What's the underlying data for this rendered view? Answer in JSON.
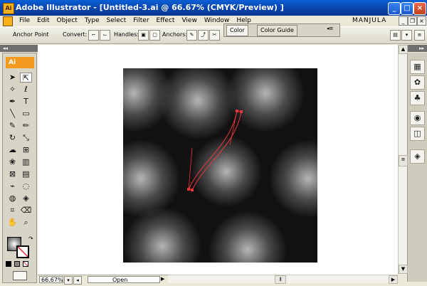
{
  "window": {
    "app_icon": "Ai",
    "title": "Adobe Illustrator - [Untitled-3.ai @ 66.67% (CMYK/Preview) ]",
    "controls": [
      "minimize-icon",
      "maximize-icon",
      "close-icon"
    ]
  },
  "menu": {
    "items": [
      "File",
      "Edit",
      "Object",
      "Type",
      "Select",
      "Filter",
      "Effect",
      "View",
      "Window",
      "Help"
    ],
    "user": "MANJULA"
  },
  "control_bar": {
    "tool_label": "Anchor Point",
    "convert_label": "Convert:",
    "handles_label": "Handles:",
    "anchors_label": "Anchors:"
  },
  "panel": {
    "tabs": [
      "Color",
      "Color Guide"
    ],
    "active_tab": "Color"
  },
  "toolbox": {
    "logo": "Ai",
    "collapse_label": "◂◂",
    "tools": [
      [
        "selection-tool",
        "direct-selection-tool"
      ],
      [
        "magic-wand-tool",
        "lasso-tool"
      ],
      [
        "pen-tool",
        "type-tool"
      ],
      [
        "line-segment-tool",
        "rectangle-tool"
      ],
      [
        "paintbrush-tool",
        "pencil-tool"
      ],
      [
        "rotate-tool",
        "scale-tool"
      ],
      [
        "warp-tool",
        "free-transform-tool"
      ],
      [
        "symbol-sprayer-tool",
        "column-graph-tool"
      ],
      [
        "mesh-tool",
        "gradient-tool"
      ],
      [
        "eyedropper-tool",
        "blend-tool"
      ],
      [
        "live-paint-bucket-tool",
        "live-paint-selection-tool"
      ],
      [
        "crop-area-tool",
        "eraser-tool"
      ],
      [
        "hand-tool",
        "zoom-tool"
      ]
    ]
  },
  "right_dock": {
    "collapse_label": "▸▸",
    "icons": [
      "swatches-icon",
      "brushes-icon",
      "symbols-icon",
      "appearance-icon",
      "graphic-styles-icon",
      "layers-icon"
    ]
  },
  "status": {
    "zoom": "66.67%",
    "status_text": "Open"
  },
  "colors": {
    "titlebar": "#0a52c9",
    "accent": "#f39a1f",
    "path_stroke": "#e8343b",
    "artboard": "#111111"
  }
}
